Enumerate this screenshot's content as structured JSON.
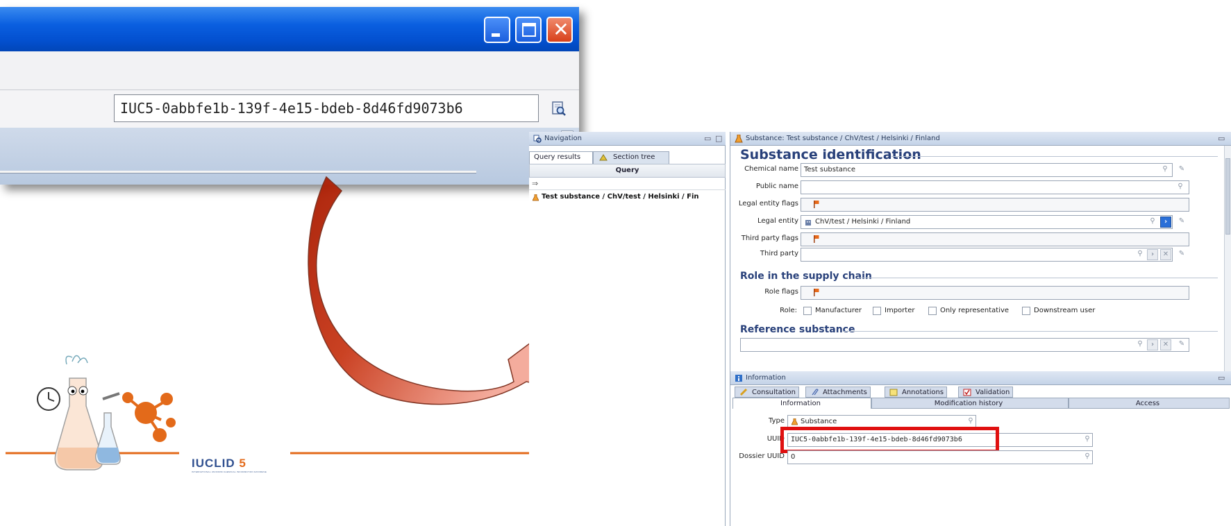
{
  "zoom_window": {
    "uuid_value": "IUC5-0abbfe1b-139f-4e15-bdeb-8d46fd9073b6"
  },
  "logo": {
    "brand": "IUCLID",
    "version": "5",
    "tagline": "INTERNATIONAL UNIFORM CHEMICAL INFORMATION DATABASE"
  },
  "navigation": {
    "title": "Navigation",
    "tabs": [
      "Query results",
      "Section tree"
    ],
    "column_header": "Query",
    "result": "Test substance / ChV/test / Helsinki / Fin"
  },
  "substance": {
    "title": "Substance: Test substance / ChV/test / Helsinki / Finland",
    "identification": {
      "heading": "Substance identification",
      "chemical_name_label": "Chemical name",
      "chemical_name": "Test substance",
      "public_name_label": "Public name",
      "public_name": "",
      "legal_entity_flags_label": "Legal entity flags",
      "legal_entity_label": "Legal entity",
      "legal_entity": "ChV/test / Helsinki / Finland",
      "third_party_flags_label": "Third party flags",
      "third_party_label": "Third party",
      "third_party": ""
    },
    "supply_chain": {
      "heading": "Role in the supply chain",
      "role_flags_label": "Role flags",
      "role_label": "Role:",
      "roles": [
        "Manufacturer",
        "Importer",
        "Only representative",
        "Downstream user"
      ]
    },
    "reference": {
      "heading": "Reference substance",
      "value": ""
    }
  },
  "information": {
    "title": "Information",
    "tabs_row1": [
      "Consultation",
      "Attachments",
      "Annotations",
      "Validation"
    ],
    "tabs_row2": [
      "Information",
      "Modification history",
      "Access"
    ],
    "type_label": "Type",
    "type_value": "Substance",
    "uuid_label": "UUID",
    "uuid_value": "IUC5-0abbfe1b-139f-4e15-bdeb-8d46fd9073b6",
    "dossier_uuid_label": "Dossier UUID",
    "dossier_uuid_value": "0"
  },
  "colors": {
    "arrow_start": "#b82000",
    "arrow_end": "#f49a88",
    "highlight": "#e01010",
    "heading": "#28407a",
    "xp_title": "#0a5fe0"
  }
}
